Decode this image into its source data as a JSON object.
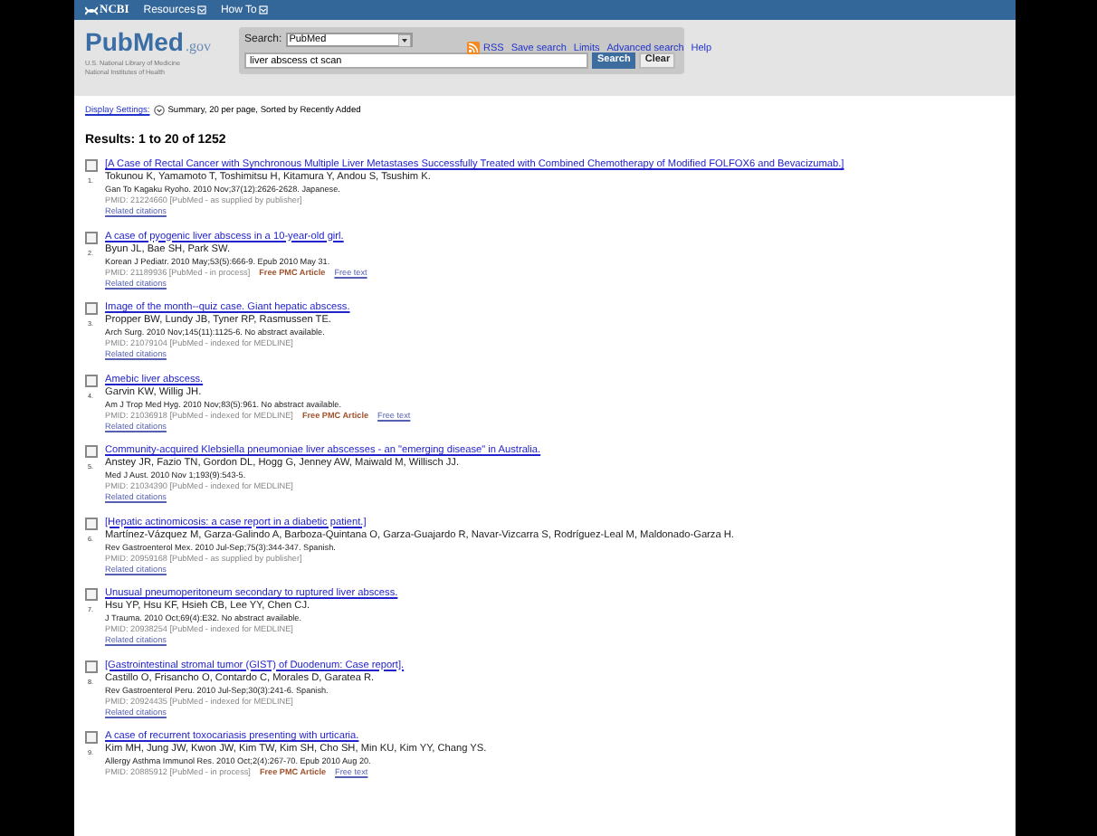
{
  "ncbi_bar": {
    "logo": "NCBI",
    "menus": [
      "Resources",
      "How To"
    ]
  },
  "header": {
    "logo": {
      "brand": "PubMed",
      "suffix": ".gov",
      "lines": [
        "U.S. National Library of Medicine",
        "National Institutes of Health"
      ]
    },
    "search_label": "Search:",
    "database": "PubMed",
    "query": "liver abscess ct scan",
    "links": [
      "RSS",
      "Save search",
      "Limits",
      "Advanced search",
      "Help"
    ],
    "search_button": "Search",
    "clear_button": "Clear"
  },
  "display": {
    "link": "Display Settings:",
    "summary": "Summary, 20 per page, Sorted by Recently Added"
  },
  "results_heading": "Results: 1 to 20 of 1252",
  "results": [
    {
      "number": "1.",
      "checked": false,
      "title": "[A Case of Rectal Cancer with Synchronous Multiple Liver Metastases Successfully Treated with Combined Chemotherapy of Modified FOLFOX6 and Bevacizumab.]",
      "authors": "Tokunou K, Yamamoto T, Toshimitsu H, Kitamura Y, Andou S, Tsushim K.",
      "journal": "Gan To Kagaku Ryoho. 2010 Nov;37(12):2626-2628. Japanese.",
      "pmid": "PMID: 21224660 [PubMed - as supplied by publisher]",
      "related": "Related citations"
    },
    {
      "number": "2.",
      "checked": false,
      "title": "A case of pyogenic liver abscess in a 10-year-old girl.",
      "authors": "Byun JL, Bae SH, Park SW.",
      "journal": "Korean J Pediatr. 2010 May;53(5):666-9. Epub 2010 May 31.",
      "pmid": "PMID: 21189936 [PubMed - in process]",
      "free_links": [
        "Free PMC Article",
        "Free text"
      ],
      "related": "Related citations"
    },
    {
      "number": "3.",
      "checked": false,
      "title": "Image of the month--quiz case. Giant hepatic abscess.",
      "authors": "Propper BW, Lundy JB, Tyner RP, Rasmussen TE.",
      "journal": "Arch Surg. 2010 Nov;145(11):1125-6. No abstract available.",
      "pmid": "PMID: 21079104 [PubMed - indexed for MEDLINE]",
      "related": "Related citations"
    },
    {
      "number": "4.",
      "checked": false,
      "title": "Amebic liver abscess.",
      "authors": "Garvin KW, Willig JH.",
      "journal": "Am J Trop Med Hyg. 2010 Nov;83(5):961. No abstract available.",
      "pmid": "PMID: 21036918 [PubMed - indexed for MEDLINE]",
      "free_links": [
        "Free PMC Article",
        "Free text"
      ],
      "related": "Related citations"
    },
    {
      "number": "5.",
      "checked": false,
      "title": "Community-acquired Klebsiella pneumoniae liver abscesses - an \"emerging disease\" in Australia.",
      "authors": "Anstey JR, Fazio TN, Gordon DL, Hogg G, Jenney AW, Maiwald M, Willisch JJ.",
      "journal": "Med J Aust. 2010 Nov 1;193(9):543-5.",
      "pmid": "PMID: 21034390 [PubMed - indexed for MEDLINE]",
      "related": "Related citations"
    },
    {
      "number": "6.",
      "checked": false,
      "title": "[Hepatic actinomicosis: a case report in a diabetic patient.]",
      "authors": "Martínez-Vázquez M, Garza-Galindo A, Barboza-Quintana O, Garza-Guajardo R, Navar-Vizcarra S, Rodríguez-Leal M, Maldonado-Garza H.",
      "journal": "Rev Gastroenterol Mex. 2010 Jul-Sep;75(3):344-347. Spanish.",
      "pmid": "PMID: 20959168 [PubMed - as supplied by publisher]",
      "related": "Related citations"
    },
    {
      "number": "7.",
      "checked": false,
      "title": "Unusual pneumoperitoneum secondary to ruptured liver abscess.",
      "authors": "Hsu YP, Hsu KF, Hsieh CB, Lee YY, Chen CJ.",
      "journal": "J Trauma. 2010 Oct;69(4):E32. No abstract available.",
      "pmid": "PMID: 20938254 [PubMed - indexed for MEDLINE]",
      "related": "Related citations"
    },
    {
      "number": "8.",
      "checked": false,
      "title": "[Gastrointestinal stromal tumor (GIST) of Duodenum: Case report].",
      "authors": "Castillo O, Frisancho O, Contardo C, Morales D, Garatea R.",
      "journal": "Rev Gastroenterol Peru. 2010 Jul-Sep;30(3):241-6. Spanish.",
      "pmid": "PMID: 20924435 [PubMed - indexed for MEDLINE]",
      "related": "Related citations"
    },
    {
      "number": "9.",
      "checked": false,
      "title": "A case of recurrent toxocariasis presenting with urticaria.",
      "authors": "Kim MH, Jung JW, Kwon JW, Kim TW, Kim SH, Cho SH, Min KU, Kim YY, Chang YS.",
      "journal": "Allergy Asthma Immunol Res. 2010 Oct;2(4):267-70. Epub 2010 Aug 20.",
      "pmid": "PMID: 20885912 [PubMed - in process]",
      "free_links": [
        "Free PMC Article",
        "Free text"
      ]
    }
  ]
}
